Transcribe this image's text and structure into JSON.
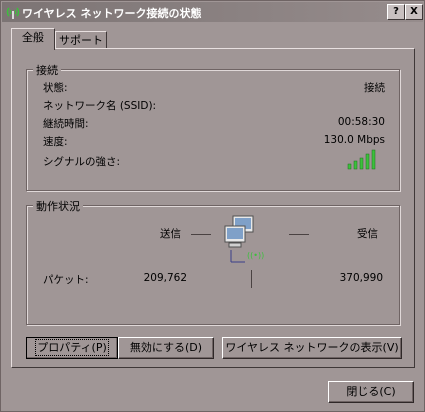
{
  "window": {
    "title": "ワイヤレス ネットワーク接続の状態",
    "help_label": "?",
    "close_label": "X"
  },
  "tabs": [
    {
      "label": "全般"
    },
    {
      "label": "サポート"
    }
  ],
  "connection": {
    "legend": "接続",
    "rows": [
      {
        "label": "状態:",
        "value": "接続"
      },
      {
        "label": "ネットワーク名 (SSID):",
        "value": ""
      },
      {
        "label": "継続時間:",
        "value": "00:58:30"
      },
      {
        "label": "速度:",
        "value": "130.0 Mbps"
      },
      {
        "label": "シグナルの強さ:",
        "value": ""
      }
    ],
    "signal_bars": 5,
    "signal_color": "#3cc03c"
  },
  "activity": {
    "legend": "動作状況",
    "sent_label": "送信",
    "received_label": "受信",
    "packets_label": "パケット:",
    "packets_sent": "209,762",
    "packets_received": "370,990",
    "wireless_glyph": "((•))"
  },
  "buttons": {
    "properties": "プロパティ(P)",
    "disable": "無効にする(D)",
    "view_networks": "ワイヤレス ネットワークの表示(V)",
    "close": "閉じる(C)"
  }
}
